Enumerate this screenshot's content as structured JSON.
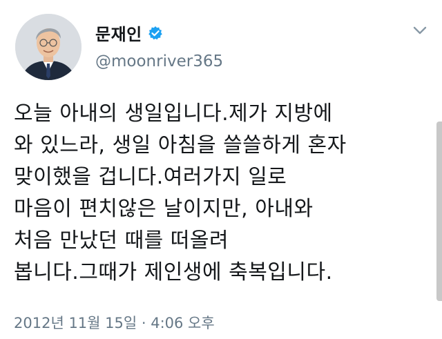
{
  "tweet": {
    "display_name": "문재인",
    "verified": true,
    "handle": "@moonriver365",
    "body_lines": [
      "오늘 아내의 생일입니다.제가 지방에",
      "와 있느라, 생일 아침을 쓸쓸하게 혼자",
      "맞이했을 겁니다.여러가지 일로",
      "마음이 편치않은 날이지만, 아내와",
      "처음 만났던 때를 떠올려",
      "봅니다.그때가 제인생에 축복입니다."
    ],
    "timestamp": "2012년 11월 15일 · 4:06 오후"
  },
  "icons": {
    "verified": "verified-badge-icon",
    "menu": "chevron-down-icon"
  },
  "colors": {
    "verified_blue": "#1da1f2",
    "secondary_text": "#657786",
    "primary_text": "#14171a"
  }
}
